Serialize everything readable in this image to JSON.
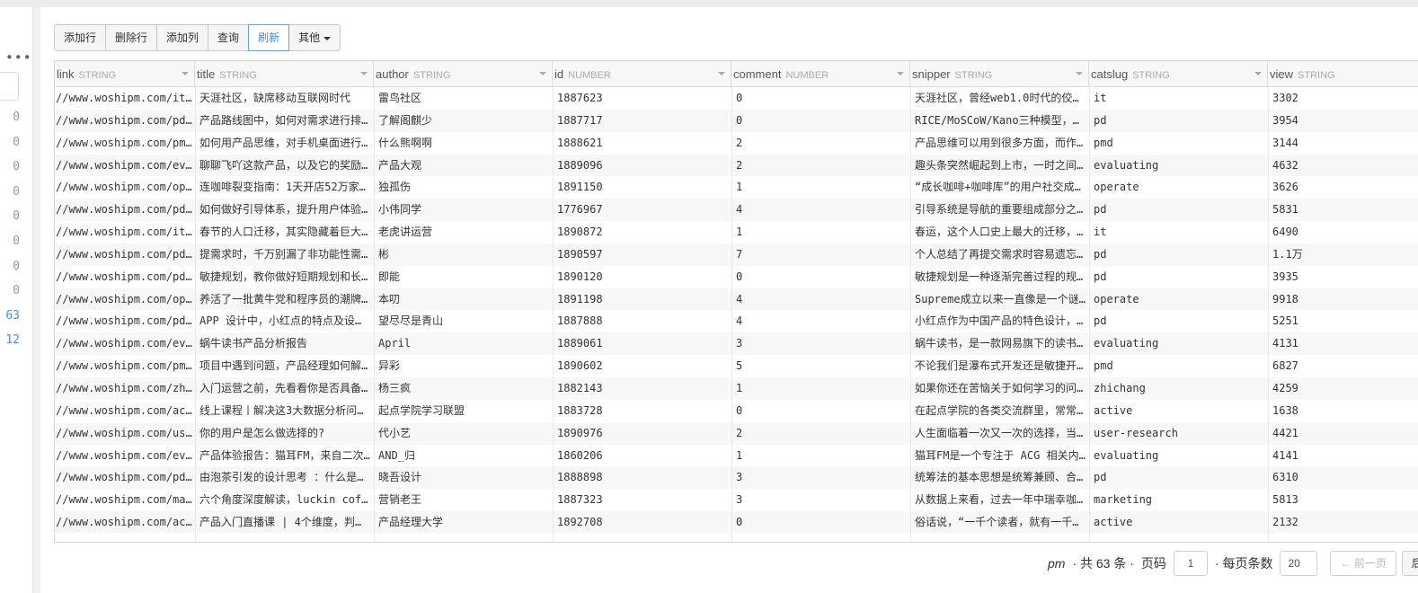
{
  "left": {
    "more_icon": "more-horizontal-icon",
    "counts": [
      "0",
      "0",
      "0",
      "0",
      "0",
      "0",
      "0",
      "0",
      "63",
      "12"
    ]
  },
  "toolbar": {
    "add_row": "添加行",
    "delete_row": "删除行",
    "add_col": "添加列",
    "query": "查询",
    "refresh": "刷新",
    "other": "其他"
  },
  "table": {
    "columns": [
      {
        "name": "link",
        "type": "STRING"
      },
      {
        "name": "title",
        "type": "STRING"
      },
      {
        "name": "author",
        "type": "STRING"
      },
      {
        "name": "id",
        "type": "NUMBER"
      },
      {
        "name": "comment",
        "type": "NUMBER"
      },
      {
        "name": "snipper",
        "type": "STRING"
      },
      {
        "name": "catslug",
        "type": "STRING"
      },
      {
        "name": "view",
        "type": "STRING"
      }
    ],
    "rows": [
      [
        "//www.woshipm.com/it…",
        "天涯社区，缺席移动互联网时代",
        "雷鸟社区",
        "1887623",
        "0",
        "天涯社区，曾经web1.0时代的佼…",
        "it",
        "3302"
      ],
      [
        "//www.woshipm.com/pd…",
        "产品路线图中，如何对需求进行排…",
        "了解阁麒少",
        "1887717",
        "0",
        "RICE/MoSCoW/Kano三种模型，…",
        "pd",
        "3954"
      ],
      [
        "//www.woshipm.com/pm…",
        "如何用产品思维，对手机桌面进行…",
        "什么熊啊啊",
        "1888621",
        "2",
        "产品思维可以用到很多方面，而作…",
        "pmd",
        "3144"
      ],
      [
        "//www.woshipm.com/ev…",
        "聊聊飞吖这款产品，以及它的奖励…",
        "产品大观",
        "1889096",
        "2",
        "趣头条突然崛起到上市，一时之间…",
        "evaluating",
        "4632"
      ],
      [
        "//www.woshipm.com/op…",
        "连咖啡裂变指南：1天开店52万家…",
        "独孤伤",
        "1891150",
        "1",
        "“成长咖啡+咖啡库”的用户社交成…",
        "operate",
        "3626"
      ],
      [
        "//www.woshipm.com/pd…",
        "如何做好引导体系，提升用户体验…",
        "小伟同学",
        "1776967",
        "4",
        "引导系统是导航的重要组成部分之…",
        "pd",
        "5831"
      ],
      [
        "//www.woshipm.com/it…",
        "春节的人口迁移，其实隐藏着巨大…",
        "老虎讲运营",
        "1890872",
        "1",
        "春运，这个人口史上最大的迁移，…",
        "it",
        "6490"
      ],
      [
        "//www.woshipm.com/pd…",
        "提需求时，千万别漏了非功能性需…",
        "彬",
        "1890597",
        "7",
        "个人总结了再提交需求时容易遗忘…",
        "pd",
        "1.1万"
      ],
      [
        "//www.woshipm.com/pd…",
        "敏捷规划，教你做好短期规划和长…",
        "即能",
        "1890120",
        "0",
        "敏捷规划是一种逐渐完善过程的规…",
        "pd",
        "3935"
      ],
      [
        "//www.woshipm.com/op…",
        "养活了一批黄牛党和程序员的潮牌…",
        "本叨",
        "1891198",
        "4",
        "Supreme成立以来一直像是一个谜…",
        "operate",
        "9918"
      ],
      [
        "//www.woshipm.com/pd…",
        "APP 设计中，小红点的特点及设…",
        "望尽尽是青山",
        "1887888",
        "4",
        "小红点作为中国产品的特色设计，…",
        "pd",
        "5251"
      ],
      [
        "//www.woshipm.com/ev…",
        "蜗牛读书产品分析报告",
        "April",
        "1889061",
        "3",
        "蜗牛读书，是一款网易旗下的读书…",
        "evaluating",
        "4131"
      ],
      [
        "//www.woshipm.com/pm…",
        "项目中遇到问题，产品经理如何解…",
        "异彩",
        "1890602",
        "5",
        "不论我们是瀑布式开发还是敏捷开…",
        "pmd",
        "6827"
      ],
      [
        "//www.woshipm.com/zh…",
        "入门运营之前，先看看你是否具备…",
        "杨三疯",
        "1882143",
        "1",
        "如果你还在苦恼关于如何学习的问…",
        "zhichang",
        "4259"
      ],
      [
        "//www.woshipm.com/ac…",
        "线上课程丨解决这3大数据分析问…",
        "起点学院学习联盟",
        "1883728",
        "0",
        "在起点学院的各类交流群里，常常…",
        "active",
        "1638"
      ],
      [
        "//www.woshipm.com/us…",
        "你的用户是怎么做选择的?",
        "代小艺",
        "1890976",
        "2",
        "人生面临着一次又一次的选择，当…",
        "user-research",
        "4421"
      ],
      [
        "//www.woshipm.com/ev…",
        "产品体验报告：猫耳FM，来自二次…",
        "AND_归",
        "1860206",
        "1",
        "猫耳FM是一个专注于 ACG 相关内…",
        "evaluating",
        "4141"
      ],
      [
        "//www.woshipm.com/pd…",
        "由泡茶引发的设计思考 ：什么是…",
        "晓吾设计",
        "1888898",
        "3",
        "统筹法的基本思想是统筹兼顾、合…",
        "pd",
        "6310"
      ],
      [
        "//www.woshipm.com/ma…",
        "六个角度深度解读，luckin cof…",
        "营销老王",
        "1887323",
        "3",
        "从数据上来看，过去一年中瑞幸咖…",
        "marketing",
        "5813"
      ],
      [
        "//www.woshipm.com/ac…",
        "产品入门直播课 | 4个维度，判…",
        "产品经理大学",
        "1892708",
        "0",
        "俗话说，“一千个读者，就有一千…",
        "active",
        "2132"
      ]
    ]
  },
  "pager": {
    "name": "pm",
    "total": "· 共 63 条 ·",
    "page_label": "页码",
    "page_value": "1",
    "per_page_label": "· 每页条数",
    "per_page_value": "20",
    "prev": "← 前一页",
    "next": "后一页"
  }
}
